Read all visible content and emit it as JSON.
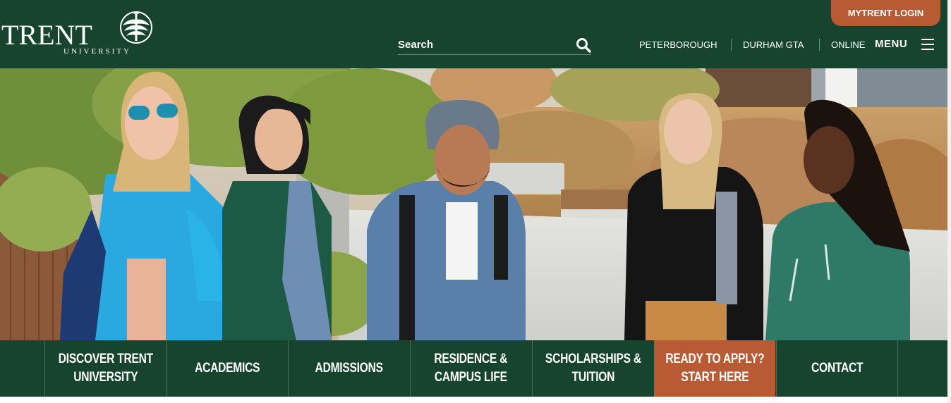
{
  "header": {
    "logo": {
      "wordmark": "TRENT",
      "subtitle": "UNIVERSITY"
    },
    "login_label": "MYTRENT LOGIN",
    "search": {
      "placeholder": "Search"
    },
    "campuses": [
      {
        "label": "PETERBOROUGH"
      },
      {
        "label": "DURHAM GTA"
      },
      {
        "label": "ONLINE"
      }
    ],
    "menu_label": "MENU"
  },
  "colors": {
    "brand_green": "#17442f",
    "accent_orange": "#b85a34",
    "text_white": "#ffffff"
  },
  "icons": {
    "search": "search-icon",
    "menu": "hamburger-icon",
    "logo": "trent-emblem-icon"
  },
  "nav": {
    "items": [
      {
        "label": "DISCOVER TRENT\nUNIVERSITY"
      },
      {
        "label": "ACADEMICS"
      },
      {
        "label": "ADMISSIONS"
      },
      {
        "label": "RESIDENCE &\nCAMPUS LIFE"
      },
      {
        "label": "SCHOLARSHIPS &\nTUITION"
      },
      {
        "label": "READY TO APPLY?\nSTART HERE"
      },
      {
        "label": "CONTACT"
      }
    ]
  }
}
